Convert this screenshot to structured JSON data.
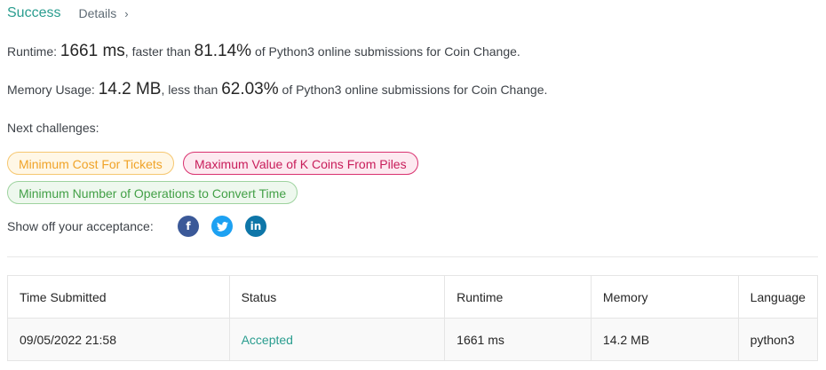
{
  "header": {
    "status": "Success",
    "details_label": "Details",
    "details_chevron": "›"
  },
  "runtime": {
    "label": "Runtime:",
    "value": "1661 ms",
    "comparison_text": ", faster than",
    "percentile": "81.14%",
    "suffix": "of Python3 online submissions for Coin Change."
  },
  "memory": {
    "label": "Memory Usage:",
    "value": "14.2 MB",
    "comparison_text": ", less than",
    "percentile": "62.03%",
    "suffix": "of Python3 online submissions for Coin Change."
  },
  "next_challenges": {
    "label": "Next challenges:",
    "items": [
      {
        "title": "Minimum Cost For Tickets",
        "difficulty": "easy"
      },
      {
        "title": "Maximum Value of K Coins From Piles",
        "difficulty": "hard"
      },
      {
        "title": "Minimum Number of Operations to Convert Time",
        "difficulty": "easy"
      }
    ]
  },
  "share": {
    "label": "Show off your acceptance:",
    "icons": [
      "facebook-icon",
      "twitter-icon",
      "linkedin-icon"
    ]
  },
  "table": {
    "headers": [
      "Time Submitted",
      "Status",
      "Runtime",
      "Memory",
      "Language"
    ],
    "rows": [
      [
        "09/05/2022 21:58",
        "Accepted",
        "1661 ms",
        "14.2 MB",
        "python3"
      ]
    ]
  },
  "colors": {
    "accent": "#2a9d8f",
    "easy": "#f0a328",
    "hard": "#c81d5a",
    "medium": "#43a047",
    "facebook": "#3b5998",
    "twitter": "#1da1f2",
    "linkedin": "#0e76a8"
  }
}
